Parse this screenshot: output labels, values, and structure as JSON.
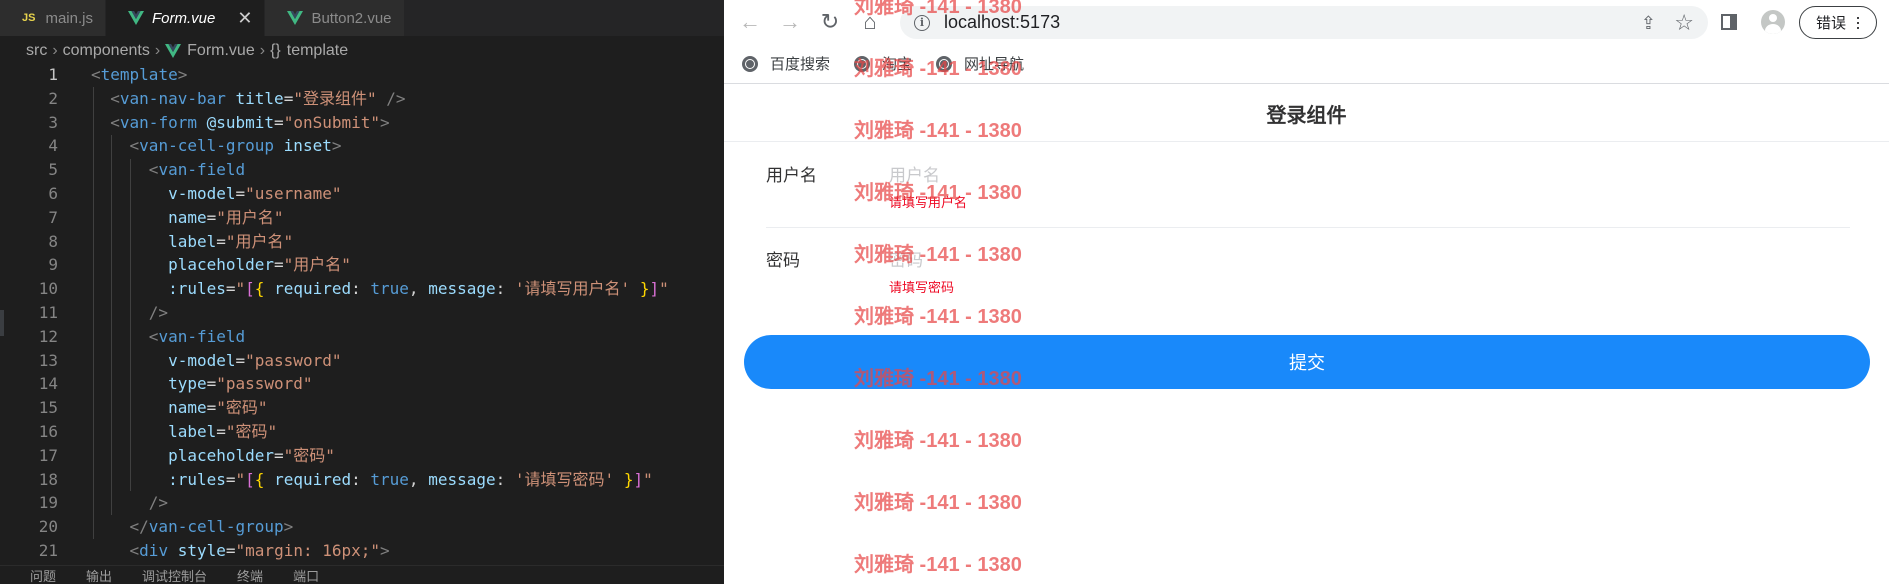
{
  "editor": {
    "tabs": [
      {
        "label": "main.js",
        "icon": "js-icon",
        "active": false
      },
      {
        "label": "Form.vue",
        "icon": "vue-icon",
        "active": true,
        "close": "✕"
      },
      {
        "label": "Button2.vue",
        "icon": "vue-icon",
        "active": false
      }
    ],
    "breadcrumb": [
      "src",
      "components",
      "Form.vue",
      "template"
    ],
    "breadcrumb_brace": "{}",
    "current_line": 1,
    "lines": [
      {
        "n": "1"
      },
      {
        "n": "2"
      },
      {
        "n": "3"
      },
      {
        "n": "4"
      },
      {
        "n": "5"
      },
      {
        "n": "6"
      },
      {
        "n": "7"
      },
      {
        "n": "8"
      },
      {
        "n": "9"
      },
      {
        "n": "10"
      },
      {
        "n": "11"
      },
      {
        "n": "12"
      },
      {
        "n": "13"
      },
      {
        "n": "14"
      },
      {
        "n": "15"
      },
      {
        "n": "16"
      },
      {
        "n": "17"
      },
      {
        "n": "18"
      },
      {
        "n": "19"
      },
      {
        "n": "20"
      },
      {
        "n": "21"
      }
    ],
    "code": {
      "l1_tag": "template",
      "l2_tag": "van-nav-bar",
      "l2_attr": "title",
      "l2_val": "\"登录组件\"",
      "l3_tag": "van-form",
      "l3_attr": "@submit",
      "l3_val": "\"onSubmit\"",
      "l4_tag": "van-cell-group",
      "l4_attr": "inset",
      "l5_tag": "van-field",
      "l6_attr": "v-model",
      "l6_val": "\"username\"",
      "l7_attr": "name",
      "l7_val": "\"用户名\"",
      "l8_attr": "label",
      "l8_val": "\"用户名\"",
      "l9_attr": "placeholder",
      "l9_val": "\"用户名\"",
      "l10_attr": ":rules",
      "l10_key1": "required",
      "l10_kw": "true",
      "l10_key2": "message",
      "l10_msg": "'请填写用户名'",
      "l12_tag": "van-field",
      "l13_attr": "v-model",
      "l13_val": "\"password\"",
      "l14_attr": "type",
      "l14_val": "\"password\"",
      "l15_attr": "name",
      "l15_val": "\"密码\"",
      "l16_attr": "label",
      "l16_val": "\"密码\"",
      "l17_attr": "placeholder",
      "l17_val": "\"密码\"",
      "l18_attr": ":rules",
      "l18_key1": "required",
      "l18_kw": "true",
      "l18_key2": "message",
      "l18_msg": "'请填写密码'",
      "l20_tag": "van-cell-group",
      "l21_tag": "div",
      "l21_attr": "style",
      "l21_val": "\"margin: 16px;\""
    },
    "panel_tabs": [
      "问题",
      "输出",
      "调试控制台",
      "终端",
      "端口"
    ]
  },
  "browser": {
    "url": "localhost:5173",
    "error_label": "错误",
    "bookmarks": [
      "百度搜索",
      "淘宝",
      "网址导航"
    ],
    "page": {
      "title": "登录组件",
      "fields": [
        {
          "label": "用户名",
          "placeholder": "用户名",
          "error": "请填写用户名"
        },
        {
          "label": "密码",
          "placeholder": "密码",
          "error": "请填写密码"
        }
      ],
      "submit_label": "提交"
    }
  },
  "watermark": {
    "text": "刘雅琦 -141 - 1380",
    "count": 10
  },
  "colors": {
    "vue_green": "#41b883",
    "js_yellow": "#e8d44d",
    "submit_blue": "#1989fa",
    "error_red": "#ee0a24",
    "watermark_red": "#e84646"
  }
}
